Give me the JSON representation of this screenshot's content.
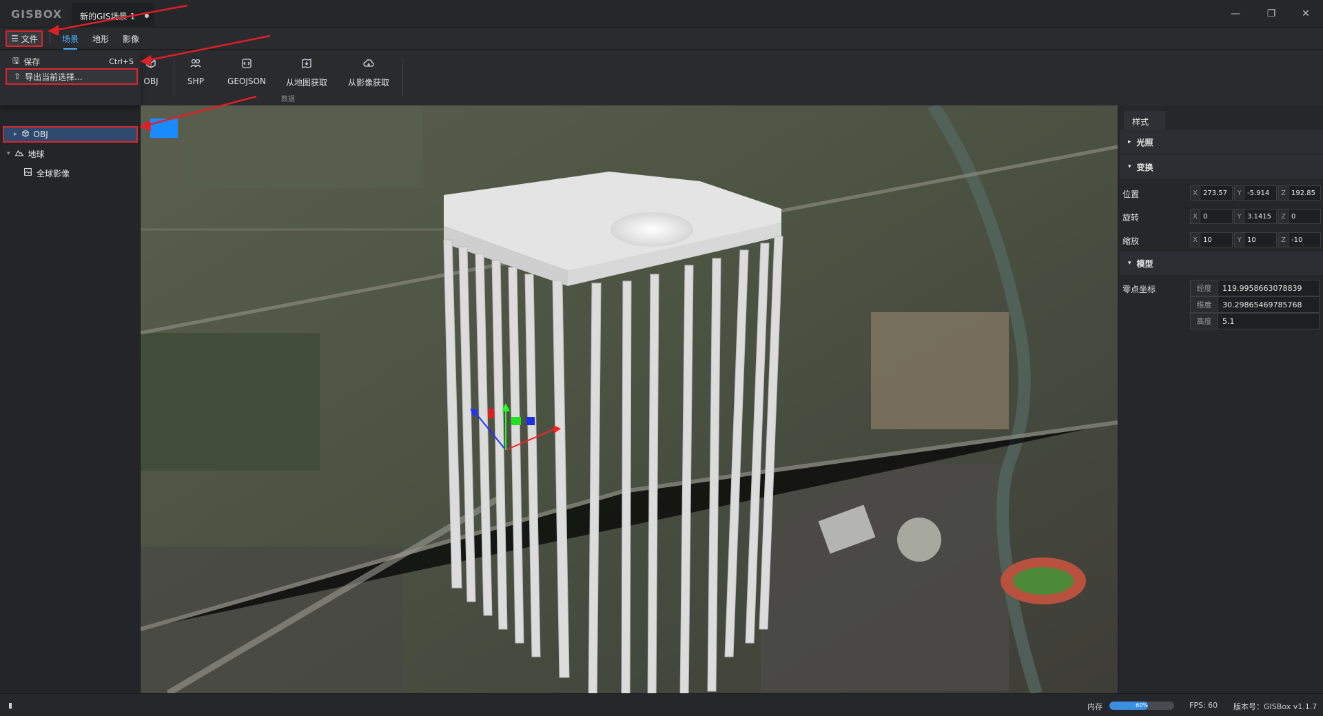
{
  "titlebar": {
    "logo": "GISBOX",
    "doc_tab": "新的GIS场景-1",
    "window_controls": [
      "minimize-icon",
      "restore-icon",
      "close-icon"
    ]
  },
  "menubar": {
    "file_label": "文件",
    "tabs": [
      "场景",
      "地形",
      "影像"
    ],
    "active_tab": "场景"
  },
  "file_menu": {
    "items": [
      {
        "label": "保存",
        "shortcut": "Ctrl+S",
        "icon": "save-icon"
      },
      {
        "label": "导出当前选择...",
        "shortcut": "",
        "icon": "export-icon"
      }
    ]
  },
  "ribbon": {
    "items": [
      "OBJ",
      "SHP",
      "GEOJSON",
      "从地图获取",
      "从影像获取"
    ],
    "group_label": "数据"
  },
  "scene_tree": {
    "items": [
      {
        "label": "OBJ",
        "icon": "cube-icon",
        "selected": true
      },
      {
        "label": "地球",
        "icon": "globe-icon",
        "selected": false
      },
      {
        "label": "全球影像",
        "icon": "image-icon",
        "selected": false
      }
    ]
  },
  "properties": {
    "tab": "样式",
    "sections": {
      "lighting": "光照",
      "transform": "变换",
      "model": "模型"
    },
    "position_label": "位置",
    "rotation_label": "旋转",
    "scale_label": "缩放",
    "position": {
      "x": "273.57",
      "y": "-5.914",
      "z": "192.85"
    },
    "rotation": {
      "x": "0",
      "y": "3.1415",
      "z": "0"
    },
    "scale": {
      "x": "10",
      "y": "10",
      "z": "-10"
    },
    "origin_label": "零点坐标",
    "longitude_label": "经度",
    "latitude_label": "维度",
    "height_label": "高度",
    "longitude": "119.9958663078839",
    "latitude": "30.29865469785768",
    "height": "5.1"
  },
  "statusbar": {
    "memory_label": "内存",
    "memory_percent": 60,
    "memory_text": "60%",
    "fps": "FPS: 60",
    "version": "版本号：GISBox v1.1.7"
  },
  "colors": {
    "accent": "#4fb2ff",
    "highlight": "#d9262b",
    "selection": "#2f4a6e"
  }
}
